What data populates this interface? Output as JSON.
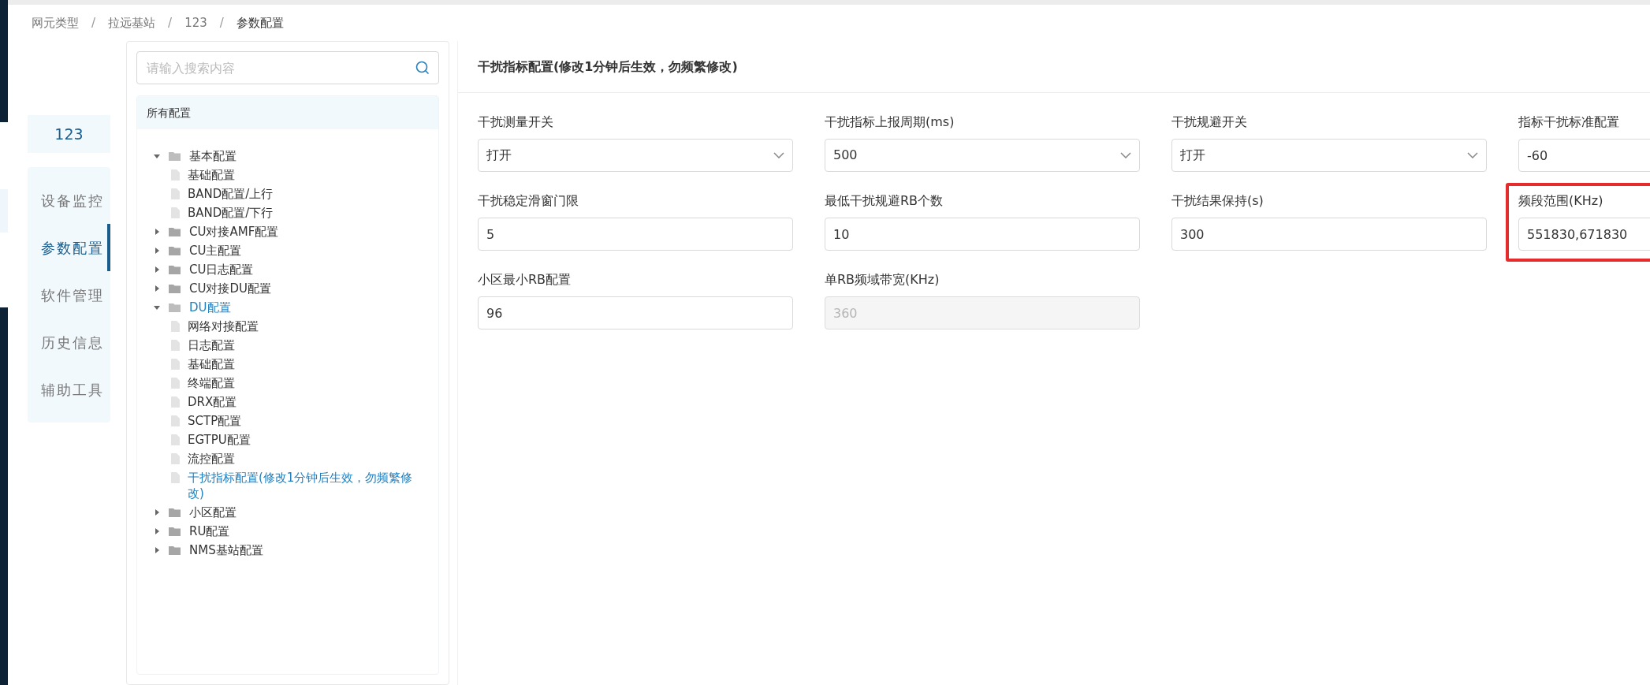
{
  "breadcrumb": {
    "separator": "/",
    "items": [
      "网元类型",
      "拉远基站",
      "123",
      "参数配置"
    ]
  },
  "device": {
    "name": "123"
  },
  "nav": [
    {
      "label": "设备监控",
      "selected": false
    },
    {
      "label": "参数配置",
      "selected": true
    },
    {
      "label": "软件管理",
      "selected": false
    },
    {
      "label": "历史信息",
      "selected": false
    },
    {
      "label": "辅助工具",
      "selected": false
    }
  ],
  "search": {
    "placeholder": "请输入搜索内容"
  },
  "tree": {
    "header": "所有配置",
    "items": [
      {
        "label": "基本配置",
        "kind": "folder",
        "expanded": true,
        "selected": false,
        "children": [
          {
            "label": "基础配置",
            "kind": "file",
            "selected": false
          },
          {
            "label": "BAND配置/上行",
            "kind": "file",
            "selected": false
          },
          {
            "label": "BAND配置/下行",
            "kind": "file",
            "selected": false
          }
        ]
      },
      {
        "label": "CU对接AMF配置",
        "kind": "folder",
        "expanded": false,
        "selected": false
      },
      {
        "label": "CU主配置",
        "kind": "folder",
        "expanded": false,
        "selected": false
      },
      {
        "label": "CU日志配置",
        "kind": "folder",
        "expanded": false,
        "selected": false
      },
      {
        "label": "CU对接DU配置",
        "kind": "folder",
        "expanded": false,
        "selected": false
      },
      {
        "label": "DU配置",
        "kind": "folder",
        "expanded": true,
        "selected": true,
        "children": [
          {
            "label": "网络对接配置",
            "kind": "file",
            "selected": false
          },
          {
            "label": "日志配置",
            "kind": "file",
            "selected": false
          },
          {
            "label": "基础配置",
            "kind": "file",
            "selected": false
          },
          {
            "label": "终端配置",
            "kind": "file",
            "selected": false
          },
          {
            "label": "DRX配置",
            "kind": "file",
            "selected": false
          },
          {
            "label": "SCTP配置",
            "kind": "file",
            "selected": false
          },
          {
            "label": "EGTPU配置",
            "kind": "file",
            "selected": false
          },
          {
            "label": "流控配置",
            "kind": "file",
            "selected": false
          },
          {
            "label": "干扰指标配置(修改1分钟后生效，勿频繁修改)",
            "kind": "file",
            "selected": true
          }
        ]
      },
      {
        "label": "小区配置",
        "kind": "folder",
        "expanded": false,
        "selected": false
      },
      {
        "label": "RU配置",
        "kind": "folder",
        "expanded": false,
        "selected": false
      },
      {
        "label": "NMS基站配置",
        "kind": "folder",
        "expanded": false,
        "selected": false
      }
    ]
  },
  "form": {
    "title": "干扰指标配置(修改1分钟后生效，勿频繁修改)",
    "fields": [
      {
        "label": "干扰测量开关",
        "kind": "select",
        "value": "打开",
        "disabled": false,
        "highlighted": false
      },
      {
        "label": "干扰指标上报周期(ms)",
        "kind": "select",
        "value": "500",
        "disabled": false,
        "highlighted": false
      },
      {
        "label": "干扰规避开关",
        "kind": "select",
        "value": "打开",
        "disabled": false,
        "highlighted": false
      },
      {
        "label": "指标干扰标准配置",
        "kind": "input",
        "value": "-60",
        "disabled": false,
        "highlighted": false
      },
      {
        "label": "干扰稳定滑窗门限",
        "kind": "input",
        "value": "5",
        "disabled": false,
        "highlighted": false
      },
      {
        "label": "最低干扰规避RB个数",
        "kind": "input",
        "value": "10",
        "disabled": false,
        "highlighted": false
      },
      {
        "label": "干扰结果保持(s)",
        "kind": "input",
        "value": "300",
        "disabled": false,
        "highlighted": false
      },
      {
        "label": "频段范围(KHz)",
        "kind": "input",
        "value": "551830,671830",
        "disabled": false,
        "highlighted": true
      },
      {
        "label": "小区最小RB配置",
        "kind": "input",
        "value": "96",
        "disabled": false,
        "highlighted": false
      },
      {
        "label": "单RB频域带宽(KHz)",
        "kind": "input",
        "value": "360",
        "disabled": true,
        "highlighted": false
      }
    ]
  }
}
